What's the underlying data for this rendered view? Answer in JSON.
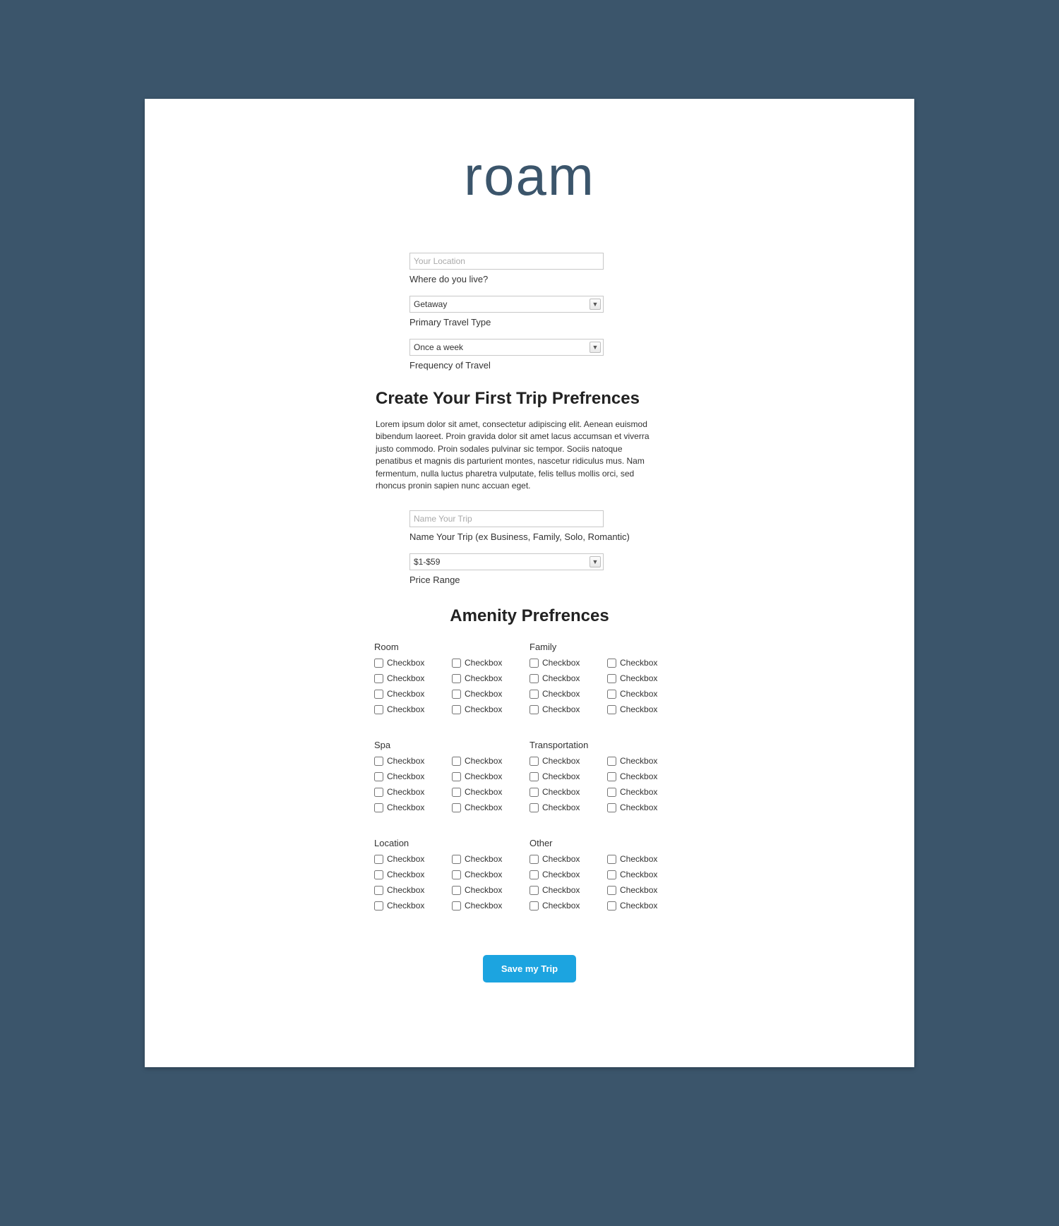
{
  "logo": "roam",
  "top": {
    "location_placeholder": "Your Location",
    "location_label": "Where do you live?",
    "travel_type_value": "Getaway",
    "travel_type_label": "Primary Travel Type",
    "frequency_value": "Once a week",
    "frequency_label": "Frequency of Travel"
  },
  "section1": {
    "heading": "Create Your First Trip Prefrences",
    "desc": "Lorem ipsum dolor sit amet, consectetur adipiscing elit. Aenean euismod bibendum laoreet. Proin gravida dolor sit amet lacus accumsan et viverra justo commodo. Proin sodales pulvinar sic tempor. Sociis natoque penatibus et magnis dis parturient montes, nascetur ridiculus mus. Nam fermentum, nulla luctus pharetra vulputate, felis tellus mollis orci, sed rhoncus pronin sapien nunc accuan eget.",
    "trip_name_placeholder": "Name Your Trip",
    "trip_name_label": "Name Your Trip (ex Business, Family, Solo, Romantic)",
    "price_value": "$1-$59",
    "price_label": "Price Range"
  },
  "section2": {
    "heading": "Amenity Prefrences",
    "checkbox_label": "Checkbox",
    "groups": [
      [
        "Room",
        "Family"
      ],
      [
        "Spa",
        "Transportation"
      ],
      [
        "Location",
        "Other"
      ]
    ]
  },
  "save_label": "Save my Trip"
}
